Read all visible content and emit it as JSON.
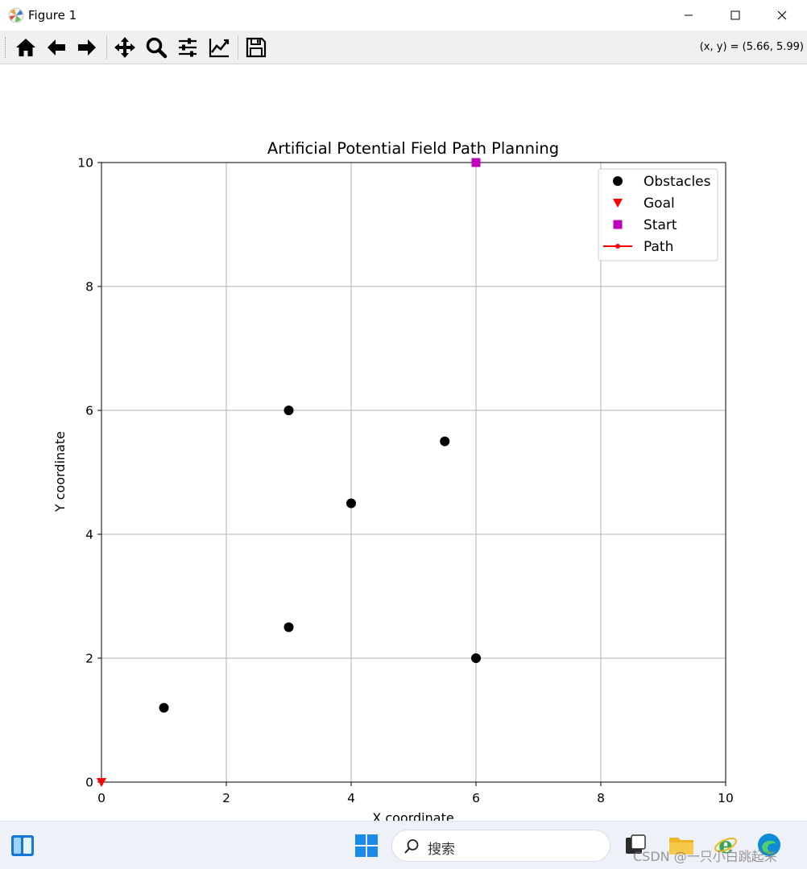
{
  "window": {
    "title": "Figure 1",
    "app_icon": "matplotlib-icon",
    "controls": [
      "minimize-icon",
      "maximize-icon",
      "close-icon"
    ]
  },
  "toolbar": {
    "buttons": [
      "home-icon",
      "back-arrow-icon",
      "forward-arrow-icon",
      "pan-icon",
      "zoom-icon",
      "subplots-icon",
      "edit-curve-icon",
      "save-icon"
    ],
    "coordinates": "(x, y) = (5.66, 5.99)"
  },
  "chart_data": {
    "type": "scatter",
    "title": "Artificial Potential Field Path Planning",
    "xlabel": "X coordinate",
    "ylabel": "Y coordinate",
    "xlim": [
      0,
      10
    ],
    "ylim": [
      0,
      10
    ],
    "xticks": [
      "0",
      "2",
      "4",
      "6",
      "8",
      "10"
    ],
    "yticks": [
      "0",
      "2",
      "4",
      "6",
      "8",
      "10"
    ],
    "grid": true,
    "legend_position": "top-right",
    "series": [
      {
        "name": "Obstacles",
        "marker": "circle",
        "color": "#000000",
        "points": [
          [
            1,
            1.2
          ],
          [
            3,
            2.5
          ],
          [
            3,
            6
          ],
          [
            4,
            4.5
          ],
          [
            5.5,
            5.5
          ],
          [
            6,
            2
          ]
        ]
      },
      {
        "name": "Goal",
        "marker": "triangle-down",
        "color": "#ff0000",
        "points": [
          [
            0,
            0
          ]
        ]
      },
      {
        "name": "Start",
        "marker": "square",
        "color": "#bf00bf",
        "points": [
          [
            6,
            10
          ]
        ]
      },
      {
        "name": "Path",
        "marker": "line-dot",
        "color": "#ff0000",
        "points": []
      }
    ]
  },
  "taskbar": {
    "icons": [
      "widgets-icon",
      "windows-start-icon",
      "app-icon",
      "file-explorer-icon",
      "ie-icon",
      "edge-icon"
    ],
    "search_placeholder": "搜索",
    "watermark": "CSDN @一只小白跳起来"
  }
}
